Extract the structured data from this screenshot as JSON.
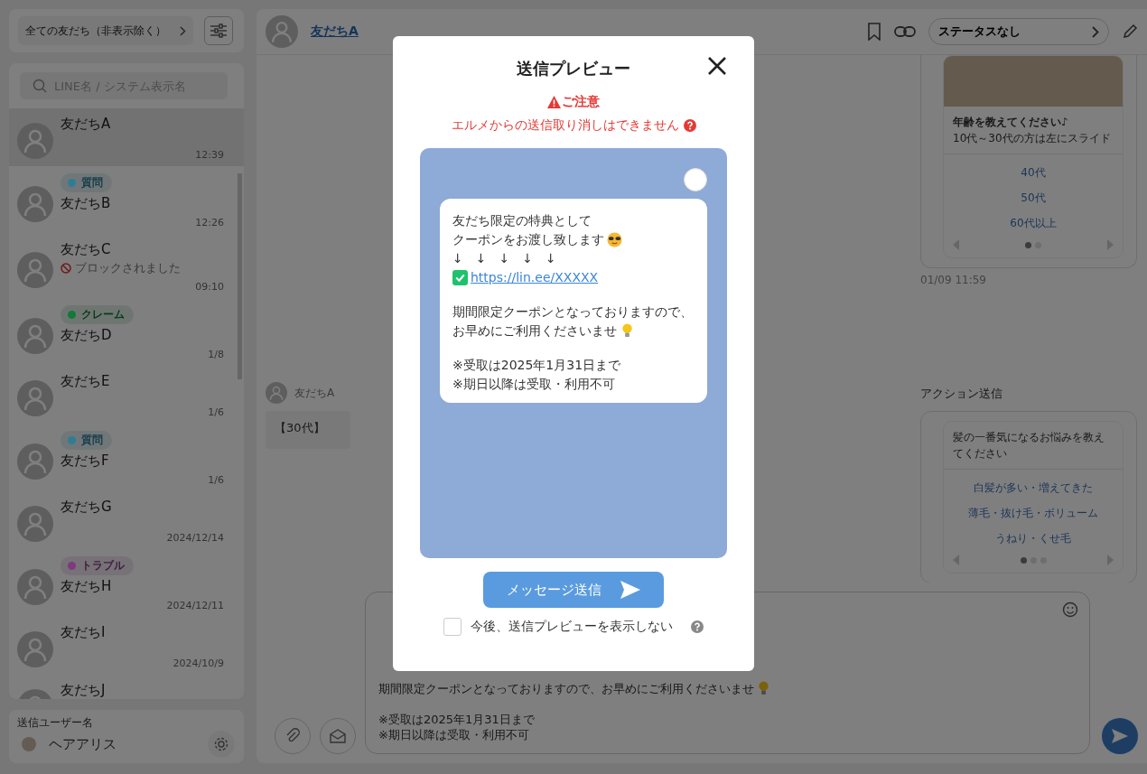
{
  "sidebar": {
    "filter": {
      "label": "全ての友だち（非表示除く）"
    },
    "search": {
      "placeholder": "LINE名 / システム表示名"
    },
    "friends": [
      {
        "name": "友だちA",
        "time": "12:39",
        "selected": true
      },
      {
        "name": "友だちB",
        "time": "12:26",
        "selected": false,
        "tag": {
          "label": "質問",
          "color": "#2f7d95"
        }
      },
      {
        "name": "友だちC",
        "time": "09:10",
        "selected": false,
        "blocked_note": "ブロックされました"
      },
      {
        "name": "友だちD",
        "time": "1/8",
        "selected": false,
        "tag": {
          "label": "クレーム",
          "color": "#0f7a3a"
        }
      },
      {
        "name": "友だちE",
        "time": "1/6",
        "selected": false
      },
      {
        "name": "友だちF",
        "time": "1/6",
        "selected": false,
        "tag": {
          "label": "質問",
          "color": "#2f7d95"
        }
      },
      {
        "name": "友だちG",
        "time": "2024/12/14",
        "selected": false
      },
      {
        "name": "友だちH",
        "time": "2024/12/11",
        "selected": false,
        "tag": {
          "label": "トラブル",
          "color": "#7d3a80"
        }
      },
      {
        "name": "友だちI",
        "time": "2024/10/9",
        "selected": false
      },
      {
        "name": "友だちJ",
        "selected": false
      }
    ],
    "sender": {
      "label": "送信ユーザー名",
      "name": "ヘアアリス"
    }
  },
  "chat": {
    "header": {
      "name": "友だちA",
      "status": "ステータスなし"
    },
    "incoming": {
      "sender": "友だちA",
      "text": "【30代】"
    },
    "cards": [
      {
        "title": "年齢を教えてください♪",
        "subtitle": "10代～30代の方は左にスライド",
        "options": [
          "40代",
          "50代",
          "60代以上"
        ],
        "dots": [
          {
            "selected": true
          },
          {
            "selected": false
          }
        ],
        "time": "01/09 11:59"
      },
      {
        "label": "アクション送信",
        "title": "髪の一番気になるお悩みを教えてください",
        "options": [
          "白髪が多い・増えてきた",
          "薄毛・抜け毛・ボリューム",
          "うねり・くせ毛"
        ],
        "dots": [
          {
            "selected": true
          },
          {
            "selected": false
          },
          {
            "selected": false
          }
        ]
      }
    ],
    "composer": {
      "paragraphs": [
        {
          "lines": [
            {
              "kind": "text_bulb",
              "text": "期間限定クーポンとなっておりますので、お早めにご利用くださいませ"
            }
          ]
        },
        {
          "lines": [
            {
              "kind": "text",
              "text": "※受取は2025年1月31日まで"
            },
            {
              "kind": "text",
              "text": "※期日以降は受取・利用不可"
            }
          ]
        }
      ]
    }
  },
  "modal": {
    "title": "送信プレビュー",
    "warning_title": "ご注意",
    "warning_text": "エルメからの送信取り消しはできません",
    "message": {
      "paragraphs": [
        {
          "lines": [
            {
              "kind": "text",
              "text": "友だち限定の特典として"
            },
            {
              "kind": "text_face",
              "text": "クーポンをお渡し致します"
            },
            {
              "kind": "text",
              "text": "↓　↓　↓　↓　↓"
            },
            {
              "kind": "link",
              "text": "https://lin.ee/XXXXX"
            }
          ]
        },
        {
          "lines": [
            {
              "kind": "text",
              "text": "期間限定クーポンとなっておりますので、"
            },
            {
              "kind": "text_bulb",
              "text": "お早めにご利用くださいませ"
            }
          ]
        },
        {
          "lines": [
            {
              "kind": "text",
              "text": "※受取は2025年1月31日まで"
            },
            {
              "kind": "text",
              "text": "※期日以降は受取・利用不可"
            }
          ]
        }
      ]
    },
    "send_button": "メッセージ送信",
    "dont_show": {
      "label": "今後、送信プレビューを表示しない",
      "checked": false
    }
  }
}
